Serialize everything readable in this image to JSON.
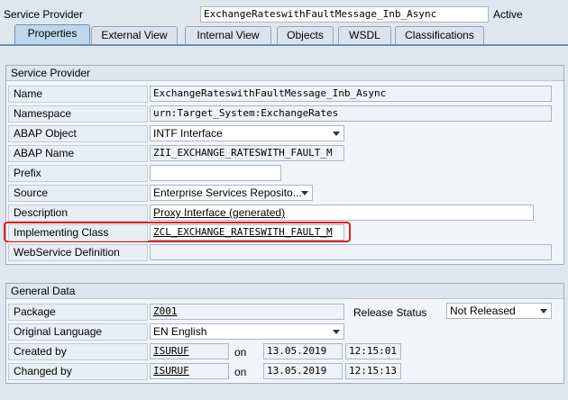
{
  "header": {
    "label": "Service Provider",
    "value": "ExchangeRateswithFaultMessage_Inb_Async",
    "status": "Active"
  },
  "tabs": [
    {
      "label": "Properties",
      "active": true
    },
    {
      "label": "External View"
    },
    {
      "label": "Internal View"
    },
    {
      "label": "Objects"
    },
    {
      "label": "WSDL"
    },
    {
      "label": "Classifications"
    }
  ],
  "service_provider": {
    "title": "Service Provider",
    "name": {
      "label": "Name",
      "value": "ExchangeRateswithFaultMessage_Inb_Async"
    },
    "namespace": {
      "label": "Namespace",
      "value": "urn:Target_System:ExchangeRates"
    },
    "abap_object": {
      "label": "ABAP Object",
      "value": "INTF Interface"
    },
    "abap_name": {
      "label": "ABAP Name",
      "value": "ZII_EXCHANGE_RATESWITH_FAULT_M"
    },
    "prefix": {
      "label": "Prefix",
      "value": ""
    },
    "source": {
      "label": "Source",
      "value": "Enterprise Services Reposito..."
    },
    "description": {
      "label": "Description",
      "value": "Proxy Interface (generated)"
    },
    "implementing_class": {
      "label": "Implementing Class",
      "value": "ZCL_EXCHANGE_RATESWITH_FAULT_M"
    },
    "webservice_definition": {
      "label": "WebService Definition",
      "value": ""
    }
  },
  "general_data": {
    "title": "General Data",
    "package": {
      "label": "Package",
      "value": "Z001"
    },
    "release_status": {
      "label": "Release Status",
      "value": "Not Released"
    },
    "original_language": {
      "label": "Original Language",
      "value": "EN English"
    },
    "created_by": {
      "label": "Created by",
      "user": "ISURUF",
      "on": "on",
      "date": "13.05.2019",
      "time": "12:15:01"
    },
    "changed_by": {
      "label": "Changed by",
      "user": "ISURUF",
      "on": "on",
      "date": "13.05.2019",
      "time": "12:15:13"
    }
  },
  "colors": {
    "highlight": "#e02020",
    "background": "#dfe6ee",
    "active_tab": "#bfd7ee"
  }
}
